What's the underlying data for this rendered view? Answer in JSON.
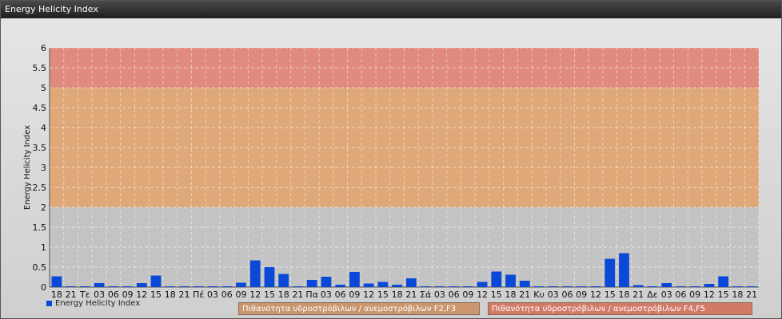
{
  "window": {
    "title": "Energy Helicity Index"
  },
  "chart_data": {
    "type": "bar",
    "ylabel": "Energy Helicity Index",
    "ylim": [
      0,
      6
    ],
    "yticks": [
      "0",
      "0.5",
      "1",
      "1.5",
      "2",
      "2.5",
      "3",
      "3.5",
      "4",
      "4.5",
      "5",
      "5.5",
      "6"
    ],
    "bands": [
      {
        "from": 0,
        "to": 2,
        "color": "#c3c3c3"
      },
      {
        "from": 2,
        "to": 5,
        "color": "#e0a774"
      },
      {
        "from": 5,
        "to": 6,
        "color": "#e2887a"
      }
    ],
    "grid": true,
    "legend_position": "bottom-left",
    "bar_color": "#0a48d8",
    "categories": [
      "18",
      "21",
      "Τε",
      "03",
      "06",
      "09",
      "12",
      "15",
      "18",
      "21",
      "Πέ",
      "03",
      "06",
      "09",
      "12",
      "15",
      "18",
      "21",
      "Πα",
      "03",
      "06",
      "09",
      "12",
      "15",
      "18",
      "21",
      "Σά",
      "03",
      "06",
      "09",
      "12",
      "15",
      "18",
      "21",
      "Κυ",
      "03",
      "06",
      "09",
      "12",
      "15",
      "18",
      "21",
      "Δε",
      "03",
      "06",
      "09",
      "12",
      "15",
      "18",
      "21"
    ],
    "series": [
      {
        "name": "Energy Helicity Index",
        "values": [
          0.27,
          0.02,
          0.02,
          0.1,
          0.02,
          0.02,
          0.1,
          0.29,
          0.02,
          0.02,
          0.02,
          0.02,
          0.02,
          0.11,
          0.67,
          0.5,
          0.33,
          0.02,
          0.18,
          0.26,
          0.06,
          0.38,
          0.09,
          0.13,
          0.06,
          0.22,
          0.02,
          0.02,
          0.02,
          0.02,
          0.13,
          0.39,
          0.31,
          0.16,
          0.02,
          0.02,
          0.02,
          0.02,
          0.02,
          0.71,
          0.85,
          0.05,
          0.02,
          0.1,
          0.02,
          0.02,
          0.08,
          0.27,
          0.02,
          0.02
        ]
      }
    ]
  },
  "legend": {
    "series_label": "Energy Helicity Index",
    "zone_f2f3": "Πιθανότητα υδροστρόβιλων / ανεμοστρόβιλων F2,F3",
    "zone_f4f5": "Πιθανότητα υδροστρόβιλων / ανεμοστρόβιλων F4,F5"
  }
}
